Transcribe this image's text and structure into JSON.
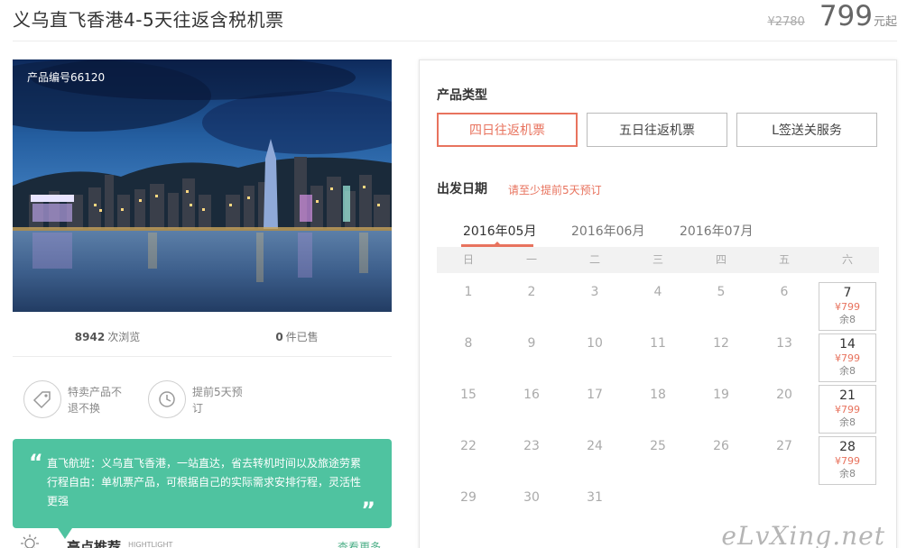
{
  "header": {
    "title": "义乌直飞香港4-5天往返含税机票",
    "old_price": "¥2780",
    "price": "799",
    "price_unit": "元起"
  },
  "product": {
    "code_label": "产品编号66120",
    "views_count": "8942",
    "views_label": "次浏览",
    "sold_count": "0",
    "sold_label": "件已售"
  },
  "features": [
    {
      "icon": "price-tag-icon",
      "text": "特卖产品不退不换"
    },
    {
      "icon": "clock-icon",
      "text": "提前5天预订"
    }
  ],
  "quote": {
    "open_mark": "“",
    "close_mark": "”",
    "lines": [
      "直飞航班：义乌直飞香港，一站直达，省去转机时间以及旅途劳累",
      "行程自由：单机票产品，可根据自己的实际需求安排行程，灵活性更强"
    ]
  },
  "highlight": {
    "title": "亮点推荐",
    "subtitle": "HIGHTLIGHT",
    "more": "查看更多"
  },
  "booking": {
    "type_title": "产品类型",
    "types": [
      "四日往返机票",
      "五日往返机票",
      "L签送关服务"
    ],
    "active_type": 0,
    "date_title": "出发日期",
    "date_hint": "请至少提前5天预订",
    "months": [
      "2016年05月",
      "2016年06月",
      "2016年07月"
    ],
    "active_month": 0,
    "weekdays": [
      "日",
      "一",
      "二",
      "三",
      "四",
      "五",
      "六"
    ],
    "weeks": [
      [
        "1",
        "2",
        "3",
        "4",
        "5",
        "6",
        "7"
      ],
      [
        "8",
        "9",
        "10",
        "11",
        "12",
        "13",
        "14"
      ],
      [
        "15",
        "16",
        "17",
        "18",
        "19",
        "20",
        "21"
      ],
      [
        "22",
        "23",
        "24",
        "25",
        "26",
        "27",
        "28"
      ],
      [
        "29",
        "30",
        "31"
      ]
    ],
    "available": [
      {
        "day": "7",
        "price": "¥799",
        "remain": "余8"
      },
      {
        "day": "14",
        "price": "¥799",
        "remain": "余8"
      },
      {
        "day": "21",
        "price": "¥799",
        "remain": "余8"
      },
      {
        "day": "28",
        "price": "¥799",
        "remain": "余8"
      }
    ]
  },
  "watermark": "eLvXing.net",
  "colors": {
    "accent": "#e8735e",
    "green": "#4fc3a0",
    "link_green": "#4fb089"
  }
}
